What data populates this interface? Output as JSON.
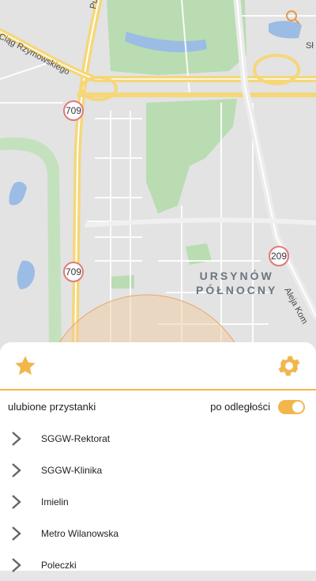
{
  "map": {
    "road_badges": [
      "709",
      "709",
      "209"
    ],
    "district_label_line1": "URSYNÓW",
    "district_label_line2": "PÓŁNOCNY",
    "street_labels": [
      "Puławska",
      "Ciąg Rzymowskiego",
      "Sł",
      "Aleja Kom"
    ],
    "colors": {
      "park": "#b9dcb2",
      "water": "#9bbce4",
      "highway": "#f5d77a",
      "radius": "#f2c89a"
    }
  },
  "sheet": {
    "favorites_icon": "star-icon",
    "settings_icon": "gear-icon",
    "accent_color": "#f1b64c",
    "filter_label": "ulubione przystanki",
    "sort_label": "po odległości",
    "sort_toggle_on": true,
    "stops": [
      {
        "name": "SGGW-Rektorat"
      },
      {
        "name": "SGGW-Klinika"
      },
      {
        "name": "Imielin"
      },
      {
        "name": "Metro Wilanowska"
      },
      {
        "name": "Poleczki"
      }
    ]
  }
}
